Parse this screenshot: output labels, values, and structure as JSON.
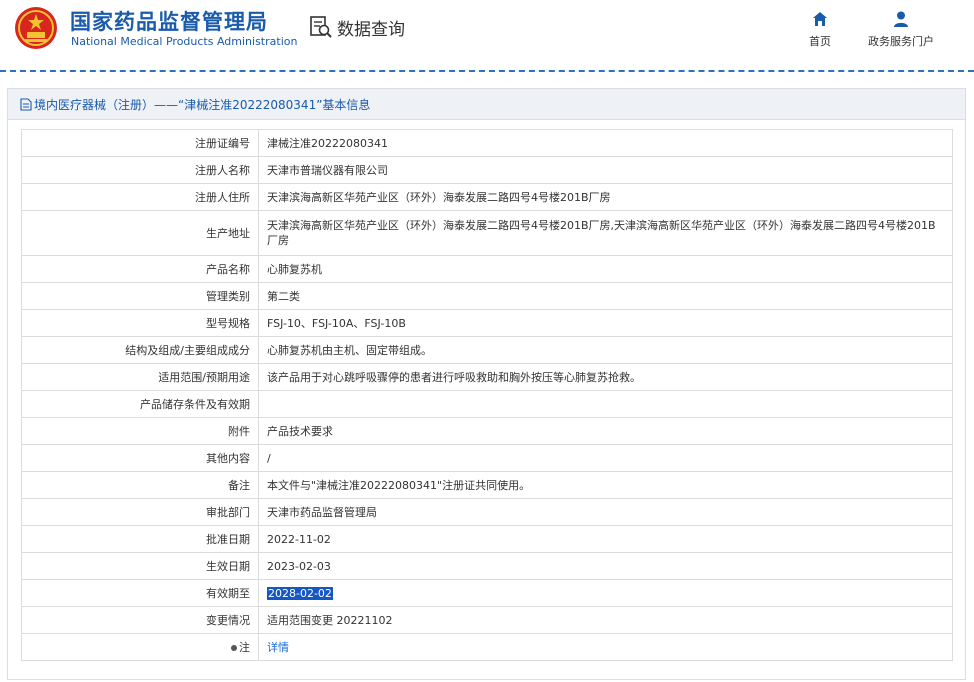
{
  "header": {
    "brand_cn": "国家药品监督管理局",
    "brand_en": "National Medical Products Administration",
    "query_label": "数据查询",
    "nav": [
      {
        "label": "首页",
        "icon": "home-icon"
      },
      {
        "label": "政务服务门户",
        "icon": "user-icon"
      }
    ]
  },
  "panel": {
    "title": "境内医疗器械（注册）——“津械注准20222080341”基本信息"
  },
  "rows": [
    {
      "label": "注册证编号",
      "value": "津械注准20222080341"
    },
    {
      "label": "注册人名称",
      "value": "天津市普瑞仪器有限公司"
    },
    {
      "label": "注册人住所",
      "value": "天津滨海高新区华苑产业区（环外）海泰发展二路四号4号楼201B厂房"
    },
    {
      "label": "生产地址",
      "value": "天津滨海高新区华苑产业区（环外）海泰发展二路四号4号楼201B厂房,天津滨海高新区华苑产业区（环外）海泰发展二路四号4号楼201B厂房"
    },
    {
      "label": "产品名称",
      "value": "心肺复苏机"
    },
    {
      "label": "管理类别",
      "value": "第二类"
    },
    {
      "label": "型号规格",
      "value": "FSJ-10、FSJ-10A、FSJ-10B"
    },
    {
      "label": "结构及组成/主要组成成分",
      "value": "心肺复苏机由主机、固定带组成。"
    },
    {
      "label": "适用范围/预期用途",
      "value": "该产品用于对心跳呼吸骤停的患者进行呼吸救助和胸外按压等心肺复苏抢救。"
    },
    {
      "label": "产品储存条件及有效期",
      "value": ""
    },
    {
      "label": "附件",
      "value": "产品技术要求"
    },
    {
      "label": "其他内容",
      "value": "/"
    },
    {
      "label": "备注",
      "value": "本文件与\"津械注准20222080341\"注册证共同使用。"
    },
    {
      "label": "审批部门",
      "value": "天津市药品监督管理局"
    },
    {
      "label": "批准日期",
      "value": "2022-11-02"
    },
    {
      "label": "生效日期",
      "value": "2023-02-03"
    },
    {
      "label": "有效期至",
      "value": "2028-02-02"
    },
    {
      "label": "变更情况",
      "value": "适用范围变更 20221102"
    },
    {
      "label": "注",
      "value": "详情"
    }
  ],
  "colors": {
    "brand_blue": "#1a5bab",
    "selection": "#1557c7",
    "link": "#1a6bd0"
  }
}
